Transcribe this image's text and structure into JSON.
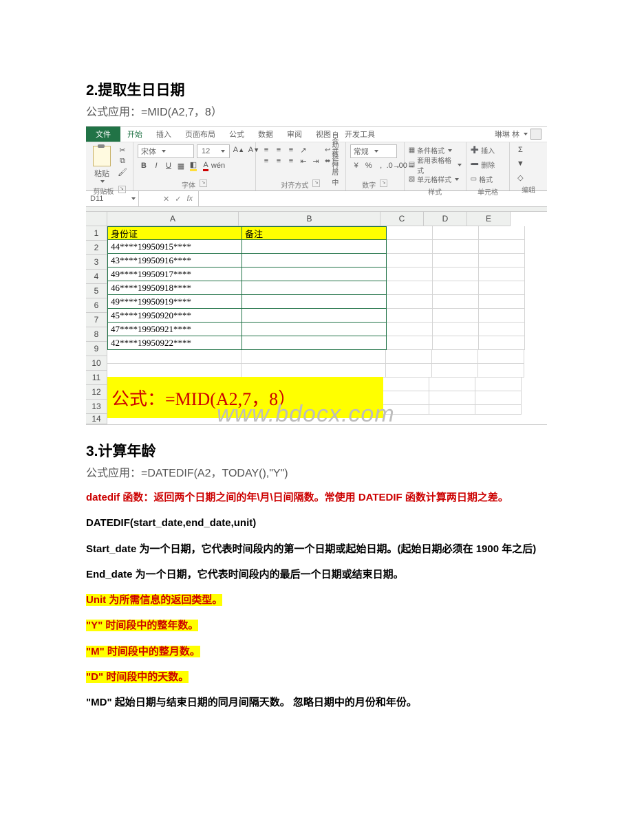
{
  "section2": {
    "heading": "2.提取生日日期",
    "formula_line": "公式应用：=MID(A2,7，8）"
  },
  "excel": {
    "tabs": {
      "file": "文件",
      "home": "开始",
      "insert": "插入",
      "layout": "页面布局",
      "formulas": "公式",
      "data": "数据",
      "review": "审阅",
      "view": "视图",
      "dev": "开发工具"
    },
    "user": "琳琳 林",
    "groups": {
      "clipboard": {
        "paste": "粘贴",
        "label": "剪贴板"
      },
      "font": {
        "name": "宋体",
        "size": "12",
        "label": "字体",
        "b": "B",
        "i": "I",
        "u": "U"
      },
      "align": {
        "label": "对齐方式",
        "wrap": "自动换行",
        "merge": "合并后居中"
      },
      "number": {
        "label": "数字",
        "general": "常规",
        "pct": "%",
        "comma": ",",
        "inc": ".0",
        "dec": ".00"
      },
      "styles": {
        "label": "样式",
        "cond": "条件格式",
        "tbl": "套用表格格式",
        "cell": "单元格样式"
      },
      "cells": {
        "label": "单元格",
        "insert": "插入",
        "delete": "删除",
        "format": "格式"
      },
      "editing": {
        "label": "编辑",
        "sum": "Σ",
        "fill": "▼",
        "clear": "◇"
      }
    },
    "name_box": "D11",
    "fx": "fx",
    "columns": [
      "A",
      "B",
      "C",
      "D",
      "E"
    ],
    "header_row": {
      "A": "身份证",
      "B": "备注"
    },
    "data": [
      "44****19950915****",
      "43****19950916****",
      "49****19950917****",
      "46****19950918****",
      "49****19950919****",
      "45****19950920****",
      "47****19950921****",
      "42****19950922****"
    ],
    "formula_box": "公式：=MID(A2,7，8）",
    "watermark": "www.bdocx.com"
  },
  "section3": {
    "heading": "3.计算年龄",
    "formula_line": "公式应用：=DATEDIF(A2，TODAY(),\"Y\")",
    "para1": "datedif 函数：返回两个日期之间的年\\月\\日间隔数。常使用 DATEDIF 函数计算两日期之差。",
    "para2": "DATEDIF(start_date,end_date,unit)",
    "para3": "Start_date 为一个日期，它代表时间段内的第一个日期或起始日期。(起始日期必须在 1900 年之后)",
    "para4": "End_date 为一个日期，它代表时间段内的最后一个日期或结束日期。",
    "para5": "Unit 为所需信息的返回类型。",
    "para6": "\"Y\" 时间段中的整年数。",
    "para7": "\"M\" 时间段中的整月数。",
    "para8": "\"D\" 时间段中的天数。",
    "para9": "\"MD\" 起始日期与结束日期的同月间隔天数。 忽略日期中的月份和年份。"
  }
}
